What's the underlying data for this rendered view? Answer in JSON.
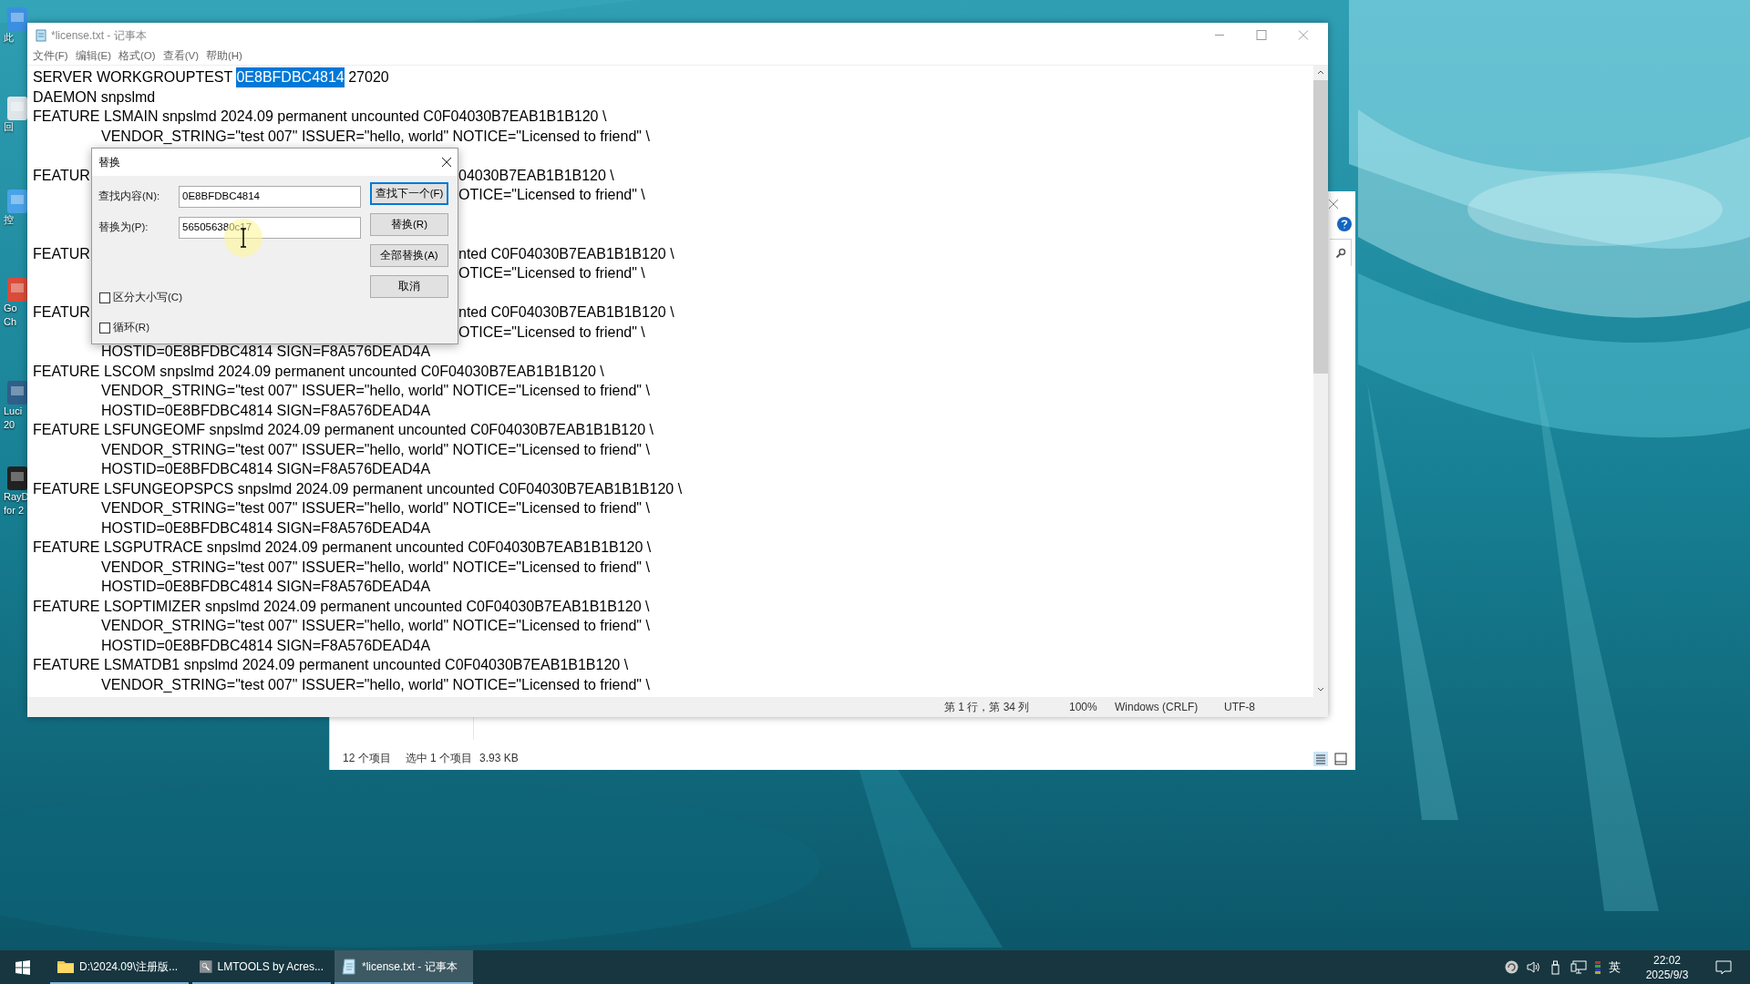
{
  "desktop": {
    "icons": [
      {
        "kind": "computer",
        "labels": [
          "此"
        ]
      },
      {
        "kind": "bin",
        "labels": [
          "回"
        ]
      },
      {
        "kind": "panel",
        "labels": [
          "控"
        ]
      },
      {
        "kind": "browser",
        "labels": [
          "Go",
          "Ch"
        ]
      },
      {
        "kind": "shortcut",
        "labels": [
          "Luci",
          "20"
        ]
      },
      {
        "kind": "app",
        "labels": [
          "RayD",
          "for 2"
        ]
      }
    ]
  },
  "explorer": {
    "status": [
      "12 个项目",
      "选中 1 个项目",
      "3.93 KB"
    ]
  },
  "notepad": {
    "title": "*license.txt - 记事本",
    "menu": [
      "文件(F)",
      "编辑(E)",
      "格式(O)",
      "查看(V)",
      "帮助(H)"
    ],
    "lines": [
      {
        "kind": "selection",
        "before": "SERVER WORKGROUPTEST ",
        "selected": "0E8BFDBC4814",
        "after": " 27020"
      },
      {
        "kind": "plain",
        "continuation": false,
        "text": "DAEMON snpslmd"
      },
      {
        "kind": "plain",
        "continuation": false,
        "text": "FEATURE LSMAIN snpslmd 2024.09 permanent uncounted C0F04030B7EAB1B1B120 \\"
      },
      {
        "kind": "plain",
        "continuation": true,
        "text": "VENDOR_STRING=\"test 007\" ISSUER=\"hello, world\" NOTICE=\"Licensed to friend\" \\"
      },
      {
        "kind": "covered"
      },
      {
        "kind": "covered",
        "left": "FEATUR",
        "right": "04030B7EAB1B1B120 \\"
      },
      {
        "kind": "covered",
        "right": "OTICE=\"Licensed to friend\" \\"
      },
      {
        "kind": "covered"
      },
      {
        "kind": "covered"
      },
      {
        "kind": "covered",
        "left": "FEATUR",
        "right": "nted C0F04030B7EAB1B1B120 \\"
      },
      {
        "kind": "covered",
        "right": "OTICE=\"Licensed to friend\" \\"
      },
      {
        "kind": "covered"
      },
      {
        "kind": "covered",
        "left": "FEATUR",
        "right": "nted C0F04030B7EAB1B1B120 \\"
      },
      {
        "kind": "covered",
        "right": "OTICE=\"Licensed to friend\" \\"
      },
      {
        "kind": "plain",
        "continuation": true,
        "text": "HOSTID=0E8BFDBC4814 SIGN=F8A576DEAD4A"
      },
      {
        "kind": "plain",
        "continuation": false,
        "text": "FEATURE LSCOM snpslmd 2024.09 permanent uncounted C0F04030B7EAB1B1B120 \\"
      },
      {
        "kind": "plain",
        "continuation": true,
        "text": "VENDOR_STRING=\"test 007\" ISSUER=\"hello, world\" NOTICE=\"Licensed to friend\" \\"
      },
      {
        "kind": "plain",
        "continuation": true,
        "text": "HOSTID=0E8BFDBC4814 SIGN=F8A576DEAD4A"
      },
      {
        "kind": "plain",
        "continuation": false,
        "text": "FEATURE LSFUNGEOMF snpslmd 2024.09 permanent uncounted C0F04030B7EAB1B1B120 \\"
      },
      {
        "kind": "plain",
        "continuation": true,
        "text": "VENDOR_STRING=\"test 007\" ISSUER=\"hello, world\" NOTICE=\"Licensed to friend\" \\"
      },
      {
        "kind": "plain",
        "continuation": true,
        "text": "HOSTID=0E8BFDBC4814 SIGN=F8A576DEAD4A"
      },
      {
        "kind": "plain",
        "continuation": false,
        "text": "FEATURE LSFUNGEOPSPCS snpslmd 2024.09 permanent uncounted C0F04030B7EAB1B1B120 \\"
      },
      {
        "kind": "plain",
        "continuation": true,
        "text": "VENDOR_STRING=\"test 007\" ISSUER=\"hello, world\" NOTICE=\"Licensed to friend\" \\"
      },
      {
        "kind": "plain",
        "continuation": true,
        "text": "HOSTID=0E8BFDBC4814 SIGN=F8A576DEAD4A"
      },
      {
        "kind": "plain",
        "continuation": false,
        "text": "FEATURE LSGPUTRACE snpslmd 2024.09 permanent uncounted C0F04030B7EAB1B1B120 \\"
      },
      {
        "kind": "plain",
        "continuation": true,
        "text": "VENDOR_STRING=\"test 007\" ISSUER=\"hello, world\" NOTICE=\"Licensed to friend\" \\"
      },
      {
        "kind": "plain",
        "continuation": true,
        "text": "HOSTID=0E8BFDBC4814 SIGN=F8A576DEAD4A"
      },
      {
        "kind": "plain",
        "continuation": false,
        "text": "FEATURE LSOPTIMIZER snpslmd 2024.09 permanent uncounted C0F04030B7EAB1B1B120 \\"
      },
      {
        "kind": "plain",
        "continuation": true,
        "text": "VENDOR_STRING=\"test 007\" ISSUER=\"hello, world\" NOTICE=\"Licensed to friend\" \\"
      },
      {
        "kind": "plain",
        "continuation": true,
        "text": "HOSTID=0E8BFDBC4814 SIGN=F8A576DEAD4A"
      },
      {
        "kind": "plain",
        "continuation": false,
        "text": "FEATURE LSMATDB1 snpslmd 2024.09 permanent uncounted C0F04030B7EAB1B1B120 \\"
      },
      {
        "kind": "plain",
        "continuation": true,
        "text": "VENDOR_STRING=\"test 007\" ISSUER=\"hello, world\" NOTICE=\"Licensed to friend\" \\"
      }
    ],
    "status_bar": [
      "第 1 行，第 34 列",
      "100%",
      "Windows (CRLF)",
      "UTF-8"
    ]
  },
  "replace_dialog": {
    "title": "替换",
    "fields": [
      {
        "label": "查找内容(N):",
        "value": "0E8BFDBC4814"
      },
      {
        "label": "替换为(P):",
        "value": "565056380c17"
      }
    ],
    "buttons": [
      {
        "label": "查找下一个(F)",
        "default": true
      },
      {
        "label": "替换(R)",
        "default": false
      },
      {
        "label": "全部替换(A)",
        "default": false
      },
      {
        "label": "取消",
        "default": false
      }
    ],
    "checkboxes": [
      {
        "label": "区分大小写(C)",
        "checked": false
      },
      {
        "label": "循环(R)",
        "checked": false
      }
    ]
  },
  "taskbar": {
    "items": [
      {
        "kind": "folder",
        "label": "D:\\2024.09\\注册版...",
        "selected": false
      },
      {
        "kind": "tool",
        "label": "LMTOOLS by Acres...",
        "selected": false
      },
      {
        "kind": "notepad",
        "label": "*license.txt - 记事本",
        "selected": true
      }
    ],
    "ime": "英",
    "time": "22:02",
    "date": "2025/9/3"
  }
}
